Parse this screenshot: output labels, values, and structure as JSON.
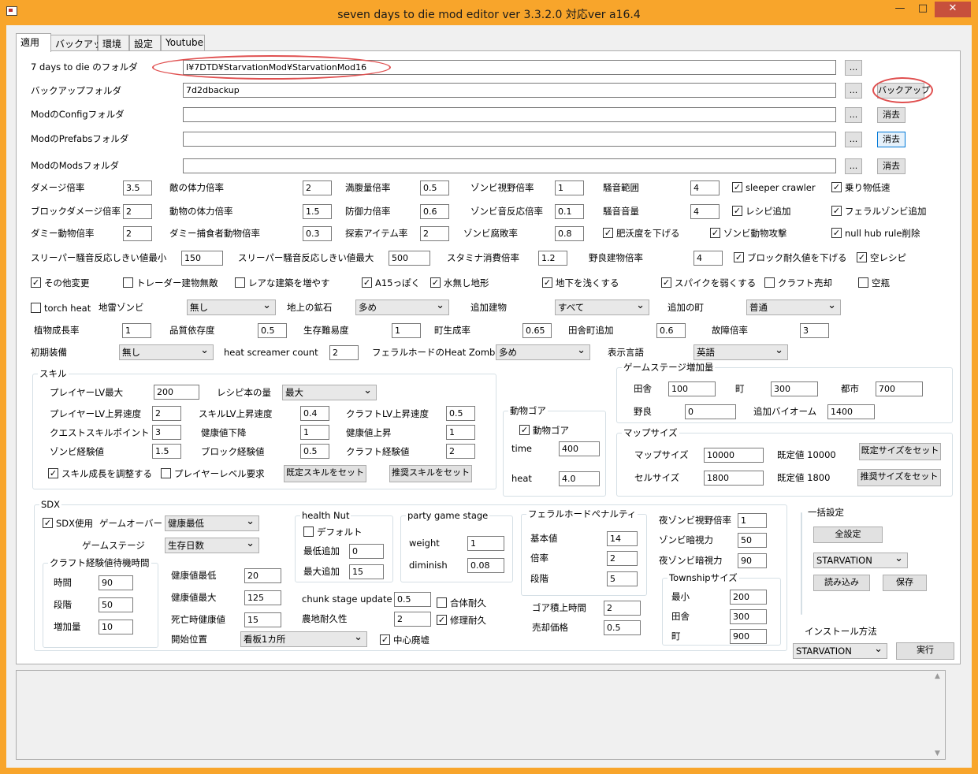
{
  "window": {
    "title": "seven days to die mod editor ver 3.3.2.0 対応ver a16.4",
    "min": "—",
    "max": "□",
    "close": "✕"
  },
  "tabs": [
    "適用",
    "バックアップ",
    "環境",
    "設定",
    "Youtube"
  ],
  "folders": [
    {
      "label": "7 days to die のフォルダ",
      "value": "I¥7DTD¥StarvationMod¥StarvationMod16",
      "browse": "...",
      "action": ""
    },
    {
      "label": "バックアップフォルダ",
      "value": "7d2dbackup",
      "browse": "...",
      "action": "バックアップ"
    },
    {
      "label": "ModのConfigフォルダ",
      "value": "",
      "browse": "...",
      "action": "消去"
    },
    {
      "label": "ModのPrefabsフォルダ",
      "value": "",
      "browse": "...",
      "action": "消去"
    },
    {
      "label": "ModのModsフォルダ",
      "value": "",
      "browse": "...",
      "action": "消去"
    }
  ],
  "rates": [
    {
      "label": "ダメージ倍率",
      "value": "3.5"
    },
    {
      "label": "敵の体力倍率",
      "value": "2"
    },
    {
      "label": "満腹量倍率",
      "value": "0.5"
    },
    {
      "label": "ゾンビ視野倍率",
      "value": "1"
    },
    {
      "label": "騒音範囲",
      "value": "4"
    },
    {
      "label": "ブロックダメージ倍率",
      "value": "2"
    },
    {
      "label": "動物の体力倍率",
      "value": "1.5"
    },
    {
      "label": "防御力倍率",
      "value": "0.6"
    },
    {
      "label": "ゾンビ音反応倍率",
      "value": "0.1"
    },
    {
      "label": "騒音音量",
      "value": "4"
    },
    {
      "label": "ダミー動物倍率",
      "value": "2"
    },
    {
      "label": "ダミー捕食者動物倍率",
      "value": "0.3"
    },
    {
      "label": "探索アイテム率",
      "value": "2"
    },
    {
      "label": "ゾンビ腐敗率",
      "value": "0.8"
    },
    {
      "label": "スリーパー騒音反応しきい値最小",
      "value": "150"
    },
    {
      "label": "スリーパー騒音反応しきい値最大",
      "value": "500"
    },
    {
      "label": "スタミナ消費倍率",
      "value": "1.2"
    },
    {
      "label": "野良建物倍率",
      "value": "4"
    }
  ],
  "checks": [
    {
      "label": "sleeper crawler",
      "checked": true
    },
    {
      "label": "乗り物低速",
      "checked": true
    },
    {
      "label": "レシピ追加",
      "checked": true
    },
    {
      "label": "フェラルゾンビ追加",
      "checked": true
    },
    {
      "label": "肥沃度を下げる",
      "checked": true
    },
    {
      "label": "ゾンビ動物攻撃",
      "checked": true
    },
    {
      "label": "null hub rule削除",
      "checked": true
    },
    {
      "label": "ブロック耐久値を下げる",
      "checked": true
    },
    {
      "label": "空レシピ",
      "checked": true
    },
    {
      "label": "その他変更",
      "checked": true
    },
    {
      "label": "トレーダー建物無敵",
      "checked": false
    },
    {
      "label": "レアな建築を増やす",
      "checked": false
    },
    {
      "label": "A15っぽく",
      "checked": true
    },
    {
      "label": "水無し地形",
      "checked": true
    },
    {
      "label": "地下を浅くする",
      "checked": true
    },
    {
      "label": "スパイクを弱くする",
      "checked": true
    },
    {
      "label": "クラフト売却",
      "checked": false
    },
    {
      "label": "空瓶",
      "checked": false
    },
    {
      "label": "torch heat",
      "checked": false
    }
  ],
  "row_dd": [
    {
      "label": "地雷ゾンビ",
      "value": "無し"
    },
    {
      "label": "地上の鉱石",
      "value": "多め"
    },
    {
      "label": "追加建物",
      "value": "すべて"
    },
    {
      "label": "追加の町",
      "value": "普通"
    }
  ],
  "row_plant": [
    {
      "label": "植物成長率",
      "value": "1"
    },
    {
      "label": "品質依存度",
      "value": "0.5"
    },
    {
      "label": "生存難易度",
      "value": "1"
    },
    {
      "label": "町生成率",
      "value": "0.65"
    },
    {
      "label": "田舎町追加",
      "value": "0.6"
    },
    {
      "label": "故障倍率",
      "value": "3"
    }
  ],
  "row_init": {
    "init_label": "初期装備",
    "init_value": "無し",
    "screamer_label": "heat screamer count",
    "screamer_value": "2",
    "feral_label": "フェラルホードのHeat Zombie量",
    "feral_value": "多め",
    "lang_label": "表示言語",
    "lang_value": "英語"
  },
  "skill": {
    "title": "スキル",
    "lvmax_label": "プレイヤーLV最大",
    "lvmax_value": "200",
    "recipe_label": "レシピ本の量",
    "recipe_value": "最大",
    "fields": [
      {
        "label": "プレイヤーLV上昇速度",
        "value": "2"
      },
      {
        "label": "スキルLV上昇速度",
        "value": "0.4"
      },
      {
        "label": "クラフトLV上昇速度",
        "value": "0.5"
      },
      {
        "label": "クエストスキルポイント",
        "value": "3"
      },
      {
        "label": "健康値下降",
        "value": "1"
      },
      {
        "label": "健康値上昇",
        "value": "1"
      },
      {
        "label": "ゾンビ経験値",
        "value": "1.5"
      },
      {
        "label": "ブロック経験値",
        "value": "0.5"
      },
      {
        "label": "クラフト経験値",
        "value": "2"
      }
    ],
    "adjust_label": "スキル成長を調整する",
    "adjust_checked": true,
    "req_label": "プレイヤーレベル要求",
    "req_checked": false,
    "default_btn": "既定スキルをセット",
    "rec_btn": "推奨スキルをセット"
  },
  "gore": {
    "title": "動物ゴア",
    "check_label": "動物ゴア",
    "checked": true,
    "time_label": "time",
    "time_value": "400",
    "heat_label": "heat",
    "heat_value": "4.0"
  },
  "gamestage": {
    "title": "ゲームステージ増加量",
    "fields": [
      {
        "label": "田舎",
        "value": "100"
      },
      {
        "label": "町",
        "value": "300"
      },
      {
        "label": "都市",
        "value": "700"
      },
      {
        "label": "野良",
        "value": "0"
      },
      {
        "label": "追加バイオーム",
        "value": "1400"
      }
    ]
  },
  "mapsize": {
    "title": "マップサイズ",
    "map_label": "マップサイズ",
    "map_value": "10000",
    "map_default": "既定値 10000",
    "map_btn": "既定サイズをセット",
    "cell_label": "セルサイズ",
    "cell_value": "1800",
    "cell_default": "既定値 1800",
    "cell_btn": "推奨サイズをセット"
  },
  "sdx": {
    "title": "SDX",
    "use_label": "SDX使用",
    "use_checked": true,
    "gameover_label": "ゲームオーバー",
    "gameover_value": "健康最低",
    "stage_label": "ゲームステージ",
    "stage_value": "生存日数",
    "craft_title": "クラフト経験値待機時間",
    "craft_fields": [
      {
        "label": "時間",
        "value": "90"
      },
      {
        "label": "段階",
        "value": "50"
      },
      {
        "label": "増加量",
        "value": "10"
      }
    ],
    "health_fields": [
      {
        "label": "健康値最低",
        "value": "20"
      },
      {
        "label": "健康値最大",
        "value": "125"
      },
      {
        "label": "死亡時健康値",
        "value": "15"
      }
    ],
    "start_label": "開始位置",
    "start_value": "看板1カ所",
    "center_label": "中心廃墟",
    "center_checked": true,
    "nut_title": "health Nut",
    "nut_default_label": "デフォルト",
    "nut_default_checked": false,
    "nut_min_label": "最低追加",
    "nut_min_value": "0",
    "nut_max_label": "最大追加",
    "nut_max_value": "15",
    "party_title": "party game stage",
    "weight_label": "weight",
    "weight_value": "1",
    "dim_label": "diminish",
    "dim_value": "0.08",
    "chunk_label": "chunk stage update",
    "chunk_value": "0.5",
    "farm_label": "農地耐久性",
    "farm_value": "2",
    "combine_label": "合体耐久",
    "combine_checked": false,
    "repair_label": "修理耐久",
    "repair_checked": true,
    "penalty_title": "フェラルホードペナルティ",
    "penalty_fields": [
      {
        "label": "基本値",
        "value": "14"
      },
      {
        "label": "倍率",
        "value": "2"
      },
      {
        "label": "段階",
        "value": "5"
      }
    ],
    "gore_time_label": "ゴア積上時間",
    "gore_time_value": "2",
    "sell_label": "売却価格",
    "sell_value": "0.5",
    "night_fields": [
      {
        "label": "夜ゾンビ視野倍率",
        "value": "1"
      },
      {
        "label": "ゾンビ暗視力",
        "value": "50"
      },
      {
        "label": "夜ゾンビ暗視力",
        "value": "90"
      }
    ],
    "township_title": "Townshipサイズ",
    "township_fields": [
      {
        "label": "最小",
        "value": "200"
      },
      {
        "label": "田舎",
        "value": "300"
      },
      {
        "label": "町",
        "value": "900"
      }
    ]
  },
  "batch": {
    "title": "一括設定",
    "all_btn": "全設定",
    "preset": "STARVATION",
    "load_btn": "読み込み",
    "save_btn": "保存",
    "install_label": "インストール方法",
    "install_value": "STARVATION",
    "run_btn": "実行"
  },
  "log": {
    "text": ""
  },
  "colors": {
    "titlebar": "#f8a52b",
    "close": "#c7503c",
    "highlight_oval": "#e05050"
  }
}
